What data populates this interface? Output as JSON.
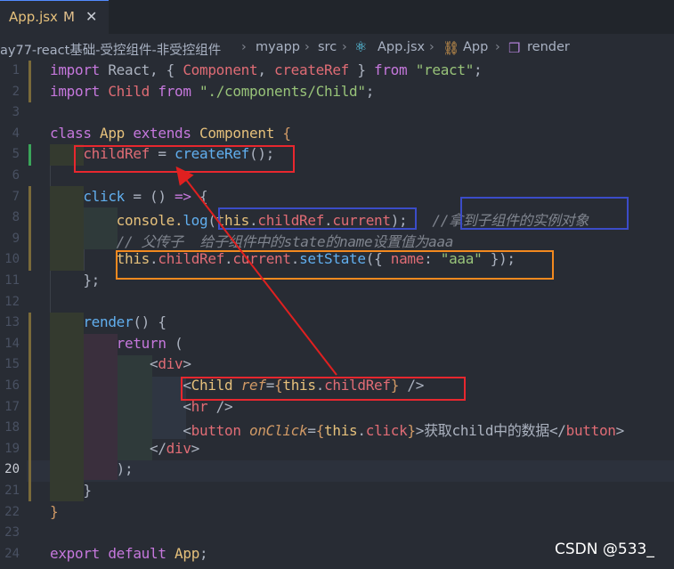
{
  "tab": {
    "label": "App.jsx",
    "modified": "M",
    "close": "✕"
  },
  "breadcrumbs": [
    "ay77-react基础-受控组件-非受控组件",
    "myapp",
    "src",
    "App.jsx",
    "App",
    "render"
  ],
  "lines": [
    {
      "n": "1"
    },
    {
      "n": "2"
    },
    {
      "n": "3"
    },
    {
      "n": "4"
    },
    {
      "n": "5"
    },
    {
      "n": "6"
    },
    {
      "n": "7"
    },
    {
      "n": "8"
    },
    {
      "n": "9"
    },
    {
      "n": "10"
    },
    {
      "n": "11"
    },
    {
      "n": "12"
    },
    {
      "n": "13"
    },
    {
      "n": "14"
    },
    {
      "n": "15"
    },
    {
      "n": "16"
    },
    {
      "n": "17"
    },
    {
      "n": "18"
    },
    {
      "n": "19"
    },
    {
      "n": "20"
    },
    {
      "n": "21"
    },
    {
      "n": "22"
    },
    {
      "n": "23"
    },
    {
      "n": "24"
    }
  ],
  "code": {
    "l1": [
      "import",
      " React, { ",
      "Component",
      ", ",
      "createRef",
      " } ",
      "from",
      " ",
      "\"react\"",
      ";"
    ],
    "l2": [
      "import",
      " ",
      "Child",
      " ",
      "from",
      " ",
      "\"./components/Child\"",
      ";"
    ],
    "l4": [
      "class",
      " ",
      "App",
      " ",
      "extends",
      " ",
      "Component",
      " {"
    ],
    "l5": [
      "    ",
      "childRef",
      " = ",
      "createRef",
      "();"
    ],
    "l7": [
      "    ",
      "click",
      " = () ",
      "=>",
      " {"
    ],
    "l8": [
      "        console.",
      "log",
      "(",
      "this",
      ".",
      "childRef",
      ".",
      "current",
      ");   ",
      "//拿到子组件的实例对象"
    ],
    "l9": [
      "        ",
      "// 父传子  给子组件中的state的name设置值为aaa"
    ],
    "l10": [
      "        ",
      "this",
      ".",
      "childRef",
      ".",
      "current",
      ".",
      "setState",
      "({ ",
      "name",
      ": ",
      "\"aaa\"",
      " });"
    ],
    "l11": [
      "    };"
    ],
    "l13": [
      "    ",
      "render",
      "() {"
    ],
    "l14": [
      "        ",
      "return",
      " ("
    ],
    "l15": [
      "            <",
      "div",
      ">"
    ],
    "l16": [
      "                <",
      "Child",
      " ",
      "ref",
      "=",
      "{",
      "this",
      ".",
      "childRef",
      "}",
      " />"
    ],
    "l17": [
      "                <",
      "hr",
      " />"
    ],
    "l18": [
      "                <",
      "button",
      " ",
      "onClick",
      "=",
      "{",
      "this",
      ".",
      "click",
      "}",
      ">获取child中的数据</",
      "button",
      ">"
    ],
    "l19": [
      "            </",
      "div",
      ">"
    ],
    "l20": [
      "        );"
    ],
    "l21": [
      "    }"
    ],
    "l22": [
      "}"
    ],
    "l24": [
      "export",
      " ",
      "default",
      " ",
      "App",
      ";"
    ]
  },
  "watermark": "CSDN @533_",
  "colors": {
    "red_box": "#e8272e",
    "blue_box": "#3b4cc8",
    "orange_box": "#f2891f",
    "arrow": "#e02020"
  }
}
